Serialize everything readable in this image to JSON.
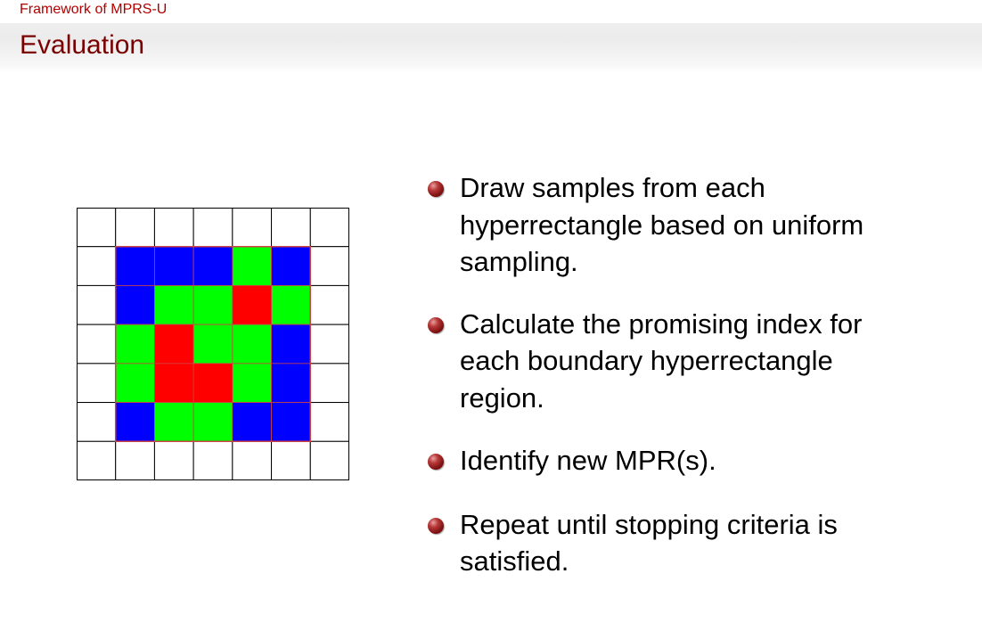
{
  "header": {
    "section": "Framework of MPRS-U",
    "title": "Evaluation"
  },
  "colors": {
    "blue": "#0000ff",
    "green": "#00ff00",
    "red": "#ff0000",
    "white": "#ffffff",
    "grid_line": "#000000",
    "region_border": "#cc4444",
    "accent_dark_red": "#7a0000"
  },
  "diagram": {
    "rows": 7,
    "cols": 7,
    "cells": [
      [
        "white",
        "white",
        "white",
        "white",
        "white",
        "white",
        "white"
      ],
      [
        "white",
        "blue",
        "blue",
        "blue",
        "green",
        "blue",
        "white"
      ],
      [
        "white",
        "blue",
        "green",
        "green",
        "red",
        "green",
        "white"
      ],
      [
        "white",
        "green",
        "red",
        "green",
        "green",
        "blue",
        "white"
      ],
      [
        "white",
        "green",
        "red",
        "red",
        "green",
        "blue",
        "white"
      ],
      [
        "white",
        "blue",
        "green",
        "green",
        "blue",
        "blue",
        "white"
      ],
      [
        "white",
        "white",
        "white",
        "white",
        "white",
        "white",
        "white"
      ]
    ]
  },
  "bullets": [
    {
      "lines": [
        "Draw samples from each",
        "hyperrectangle based on uniform",
        "sampling."
      ]
    },
    {
      "lines": [
        "Calculate the promising index for",
        "each boundary hyperrectangle",
        "region."
      ]
    },
    {
      "lines": [
        "Identify new MPR(s)."
      ]
    },
    {
      "lines": [
        "Repeat until stopping criteria is",
        "satisfied."
      ]
    }
  ]
}
